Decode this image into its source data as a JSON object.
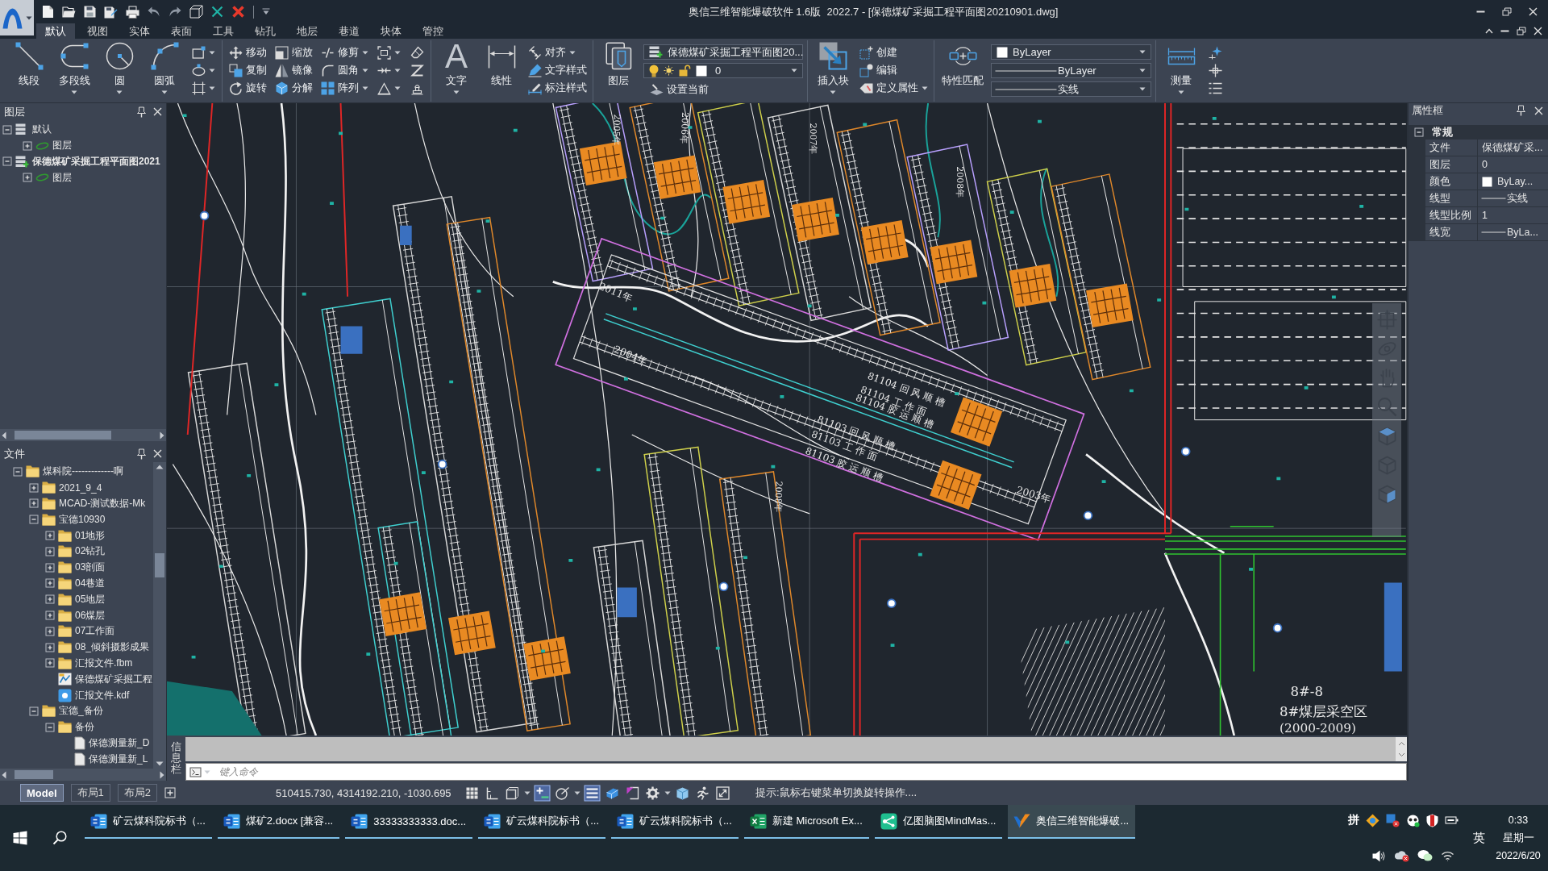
{
  "title_bar": {
    "title": "奥信三维智能爆破软件 1.6版  2022.7 - [保德煤矿采掘工程平面图20210901.dwg]"
  },
  "ribbon_tabs": [
    {
      "label": "默认",
      "selected": true
    },
    {
      "label": "视图",
      "selected": false
    },
    {
      "label": "实体",
      "selected": false
    },
    {
      "label": "表面",
      "selected": false
    },
    {
      "label": "工具",
      "selected": false
    },
    {
      "label": "钻孔",
      "selected": false
    },
    {
      "label": "地层",
      "selected": false
    },
    {
      "label": "巷道",
      "selected": false
    },
    {
      "label": "块体",
      "selected": false
    },
    {
      "label": "管控",
      "selected": false
    }
  ],
  "ribbon": {
    "draw": {
      "large": [
        {
          "label": "线段",
          "dropdown": false
        },
        {
          "label": "多段线",
          "dropdown": true
        },
        {
          "label": "圆",
          "dropdown": true
        },
        {
          "label": "圆弧",
          "dropdown": true
        }
      ],
      "tools": [
        {
          "dropdown": true
        },
        {
          "dropdown": true
        },
        {
          "dropdown": true
        }
      ]
    },
    "modify": {
      "small": [
        {
          "label": "移动",
          "dropdown": false
        },
        {
          "label": "复制",
          "dropdown": false
        },
        {
          "label": "旋转",
          "dropdown": false
        },
        {
          "label": "缩放",
          "dropdown": false
        },
        {
          "label": "镜像",
          "dropdown": false
        },
        {
          "label": "分解",
          "dropdown": false
        },
        {
          "label": "修剪",
          "dropdown": true
        },
        {
          "label": "圆角",
          "dropdown": true
        },
        {
          "label": "阵列",
          "dropdown": true
        }
      ],
      "tools": [
        {
          "dropdown": true
        },
        {
          "dropdown": true
        },
        {
          "dropdown": true
        },
        {
          "dropdown": false
        },
        {
          "dropdown": false
        },
        {
          "dropdown": false
        }
      ]
    },
    "annotate": {
      "large": [
        {
          "label": "文字",
          "glyph": "A",
          "dropdown": true
        },
        {
          "label": "线性",
          "dropdown": false
        }
      ],
      "small": [
        {
          "label": "对齐",
          "dropdown": true
        },
        {
          "label": "文字样式",
          "dropdown": false
        },
        {
          "label": "标注样式",
          "dropdown": false
        }
      ]
    },
    "layers": {
      "large": [
        {
          "label": "图层",
          "dropdown": false
        }
      ],
      "current_layer": "保德煤矿采掘工程平面图20...",
      "layer_state": "0",
      "small": [
        {
          "label": "设置当前",
          "dropdown": false
        }
      ]
    },
    "block": {
      "large": [
        {
          "label": "插入块",
          "dropdown": true
        }
      ],
      "small": [
        {
          "label": "创建",
          "dropdown": false
        },
        {
          "label": "编辑",
          "dropdown": false
        },
        {
          "label": "定义属性",
          "dropdown": true
        }
      ]
    },
    "properties": {
      "large": [
        {
          "label": "特性匹配",
          "dropdown": false
        }
      ],
      "selects": [
        {
          "kind": "color",
          "value": "ByLayer"
        },
        {
          "kind": "line",
          "value": "ByLayer"
        },
        {
          "kind": "line",
          "value": "实线"
        }
      ]
    },
    "measure": {
      "large": [
        {
          "label": "测量",
          "dropdown": true
        }
      ],
      "tools": [
        {
          "dropdown": false
        },
        {
          "dropdown": false
        },
        {
          "dropdown": false
        }
      ]
    }
  },
  "layer_panel": {
    "title": "图层",
    "tree": [
      {
        "label": "默认",
        "kind": "layers",
        "active": false,
        "expanded": true,
        "children": [
          {
            "label": "图层",
            "kind": "layer",
            "expanded": false
          }
        ]
      },
      {
        "label": "保德煤矿采掘工程平面图2021",
        "kind": "layers",
        "active": true,
        "expanded": true,
        "children": [
          {
            "label": "图层",
            "kind": "layer",
            "expanded": false
          }
        ]
      }
    ]
  },
  "file_panel": {
    "title": "文件",
    "tree": [
      {
        "label": "煤科院-------------啊",
        "kind": "folder",
        "expanded": true,
        "children": [
          {
            "label": "2021_9_4",
            "kind": "folder",
            "expanded": false
          },
          {
            "label": "MCAD-测试数据-Mk",
            "kind": "folder",
            "expanded": false
          },
          {
            "label": "宝德10930",
            "kind": "folder",
            "expanded": true,
            "children": [
              {
                "label": "01地形",
                "kind": "folder",
                "expanded": false
              },
              {
                "label": "02钻孔",
                "kind": "folder",
                "expanded": false
              },
              {
                "label": "03剖面",
                "kind": "folder",
                "expanded": false
              },
              {
                "label": "04巷道",
                "kind": "folder",
                "expanded": false
              },
              {
                "label": "05地层",
                "kind": "folder",
                "expanded": false
              },
              {
                "label": "06煤层",
                "kind": "folder",
                "expanded": false
              },
              {
                "label": "07工作面",
                "kind": "folder",
                "expanded": false
              },
              {
                "label": "08_倾斜摄影成果",
                "kind": "folder",
                "expanded": false
              },
              {
                "label": "汇报文件.fbm",
                "kind": "folder",
                "expanded": false
              },
              {
                "label": "保德煤矿采掘工程",
                "kind": "drawing"
              },
              {
                "label": "汇报文件.kdf",
                "kind": "report"
              }
            ]
          },
          {
            "label": "宝德_备份",
            "kind": "folder",
            "expanded": true,
            "children": [
              {
                "label": "备份",
                "kind": "folder",
                "expanded": true,
                "children": [
                  {
                    "label": "保德测量新_D",
                    "kind": "file"
                  },
                  {
                    "label": "保德测量新_L",
                    "kind": "file"
                  }
                ]
              }
            ]
          }
        ]
      }
    ]
  },
  "drawing": {
    "labels": [
      "8#-8",
      "8#煤层采空区",
      "(2000-2009)",
      "2011年",
      "2004年",
      "2003年",
      "81104 回 风 顺 槽",
      "81104 工 作 面",
      "81104 胶 运 顺 槽",
      "81103 回 风 顺 槽",
      "81103 工 作 面",
      "81103 胶 运 顺 槽",
      "2005年",
      "2006年",
      "2007年",
      "2008年",
      "2008年"
    ]
  },
  "command_line": {
    "title": "信息栏",
    "placeholder": "键入命令"
  },
  "properties_panel": {
    "title": "属性框",
    "group": {
      "label": "常规",
      "expanded": true
    },
    "rows": [
      {
        "label": "文件",
        "kind": "text",
        "value": "保德煤矿采..."
      },
      {
        "label": "图层",
        "kind": "text",
        "value": "0"
      },
      {
        "label": "颜色",
        "kind": "color",
        "value": "ByLay..."
      },
      {
        "label": "线型",
        "kind": "line",
        "value": "实线"
      },
      {
        "label": "线型比例",
        "kind": "text",
        "value": "1"
      },
      {
        "label": "线宽",
        "kind": "line",
        "value": "ByLa..."
      }
    ]
  },
  "status_bar": {
    "layout_tabs": [
      {
        "label": "Model",
        "selected": true
      },
      {
        "label": "布局1",
        "selected": false
      },
      {
        "label": "布局2",
        "selected": false
      }
    ],
    "coordinates": "510415.730, 4314192.210, -1030.695",
    "tools": [
      {
        "on": false,
        "dropdown": false
      },
      {
        "on": false,
        "dropdown": false
      },
      {
        "on": false,
        "dropdown": true
      },
      {
        "on": true,
        "dropdown": false
      },
      {
        "on": false,
        "dropdown": true
      },
      {
        "on": true,
        "dropdown": false
      },
      {
        "on": false,
        "dropdown": false
      },
      {
        "on": false,
        "dropdown": false
      },
      {
        "on": false,
        "dropdown": true
      },
      {
        "on": false,
        "dropdown": false
      },
      {
        "on": false,
        "dropdown": false
      },
      {
        "on": false,
        "dropdown": false
      }
    ],
    "hint": "提示:鼠标右键菜单切换旋转操作...."
  },
  "taskbar": {
    "apps": [
      {
        "label": "矿云煤科院标书（...",
        "kind": "document",
        "selected": false
      },
      {
        "label": "煤矿2.docx [兼容...",
        "kind": "document",
        "selected": false
      },
      {
        "label": "33333333333.doc...",
        "kind": "document",
        "selected": false
      },
      {
        "label": "矿云煤科院标书（...",
        "kind": "document",
        "selected": false
      },
      {
        "label": "矿云煤科院标书（...",
        "kind": "document",
        "selected": false
      },
      {
        "label": "新建 Microsoft Ex...",
        "kind": "spreadsheet",
        "selected": false
      },
      {
        "label": "亿图脑图MindMas...",
        "kind": "mindmap",
        "selected": false
      },
      {
        "label": "奥信三维智能爆破...",
        "kind": "app",
        "selected": true
      }
    ],
    "tray": {
      "ime": "拼",
      "language": "英",
      "time": "0:33",
      "weekday": "星期一",
      "date": "2022/6/20"
    }
  }
}
